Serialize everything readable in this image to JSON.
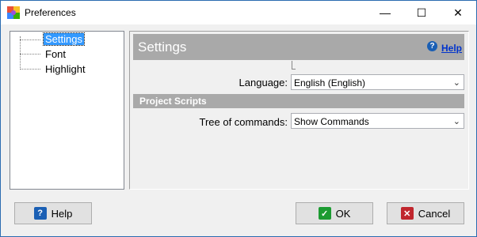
{
  "window": {
    "title": "Preferences",
    "minimize_glyph": "—",
    "maximize_glyph": "☐",
    "close_glyph": "✕"
  },
  "tree": {
    "items": [
      {
        "label": "Settings",
        "selected": true
      },
      {
        "label": "Font",
        "selected": false
      },
      {
        "label": "Highlight",
        "selected": false
      }
    ]
  },
  "settings": {
    "header_title": "Settings",
    "help_link": "Help",
    "language_label": "Language:",
    "language_value": "English (English)",
    "section_title": "Project Scripts",
    "tree_label": "Tree of commands:",
    "tree_value": "Show Commands"
  },
  "footer": {
    "help_button": "Help",
    "ok_button": "OK",
    "cancel_button": "Cancel"
  },
  "colors": {
    "header_bg": "#a9a9a9",
    "selection": "#3399ff",
    "ok_icon": "#1c9b31",
    "cancel_icon": "#c0262d",
    "help_icon": "#1a5fb4"
  },
  "icons": [
    "app-icon",
    "minimize-icon",
    "maximize-icon",
    "close-icon",
    "help-circle-icon",
    "chevron-down-icon",
    "help-icon",
    "check-icon",
    "x-icon"
  ]
}
